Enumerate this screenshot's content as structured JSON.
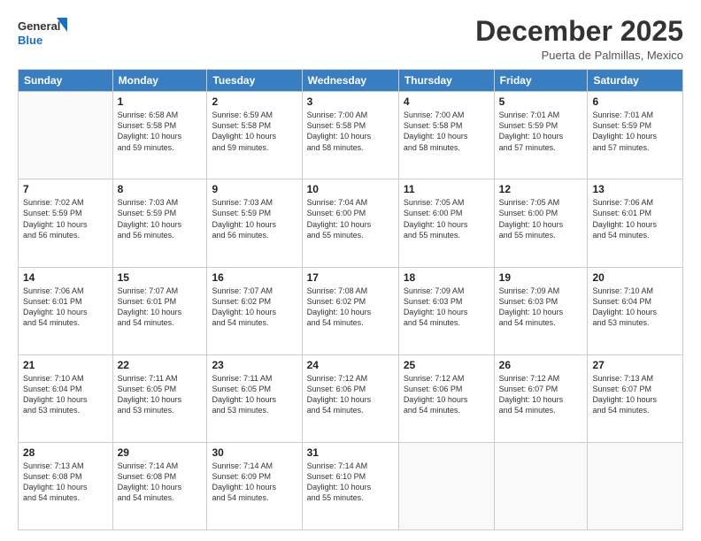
{
  "logo": {
    "general": "General",
    "blue": "Blue"
  },
  "header": {
    "month": "December 2025",
    "location": "Puerta de Palmillas, Mexico"
  },
  "weekdays": [
    "Sunday",
    "Monday",
    "Tuesday",
    "Wednesday",
    "Thursday",
    "Friday",
    "Saturday"
  ],
  "weeks": [
    [
      {
        "day": "",
        "info": ""
      },
      {
        "day": "1",
        "info": "Sunrise: 6:58 AM\nSunset: 5:58 PM\nDaylight: 10 hours\nand 59 minutes."
      },
      {
        "day": "2",
        "info": "Sunrise: 6:59 AM\nSunset: 5:58 PM\nDaylight: 10 hours\nand 59 minutes."
      },
      {
        "day": "3",
        "info": "Sunrise: 7:00 AM\nSunset: 5:58 PM\nDaylight: 10 hours\nand 58 minutes."
      },
      {
        "day": "4",
        "info": "Sunrise: 7:00 AM\nSunset: 5:58 PM\nDaylight: 10 hours\nand 58 minutes."
      },
      {
        "day": "5",
        "info": "Sunrise: 7:01 AM\nSunset: 5:59 PM\nDaylight: 10 hours\nand 57 minutes."
      },
      {
        "day": "6",
        "info": "Sunrise: 7:01 AM\nSunset: 5:59 PM\nDaylight: 10 hours\nand 57 minutes."
      }
    ],
    [
      {
        "day": "7",
        "info": "Sunrise: 7:02 AM\nSunset: 5:59 PM\nDaylight: 10 hours\nand 56 minutes."
      },
      {
        "day": "8",
        "info": "Sunrise: 7:03 AM\nSunset: 5:59 PM\nDaylight: 10 hours\nand 56 minutes."
      },
      {
        "day": "9",
        "info": "Sunrise: 7:03 AM\nSunset: 5:59 PM\nDaylight: 10 hours\nand 56 minutes."
      },
      {
        "day": "10",
        "info": "Sunrise: 7:04 AM\nSunset: 6:00 PM\nDaylight: 10 hours\nand 55 minutes."
      },
      {
        "day": "11",
        "info": "Sunrise: 7:05 AM\nSunset: 6:00 PM\nDaylight: 10 hours\nand 55 minutes."
      },
      {
        "day": "12",
        "info": "Sunrise: 7:05 AM\nSunset: 6:00 PM\nDaylight: 10 hours\nand 55 minutes."
      },
      {
        "day": "13",
        "info": "Sunrise: 7:06 AM\nSunset: 6:01 PM\nDaylight: 10 hours\nand 54 minutes."
      }
    ],
    [
      {
        "day": "14",
        "info": "Sunrise: 7:06 AM\nSunset: 6:01 PM\nDaylight: 10 hours\nand 54 minutes."
      },
      {
        "day": "15",
        "info": "Sunrise: 7:07 AM\nSunset: 6:01 PM\nDaylight: 10 hours\nand 54 minutes."
      },
      {
        "day": "16",
        "info": "Sunrise: 7:07 AM\nSunset: 6:02 PM\nDaylight: 10 hours\nand 54 minutes."
      },
      {
        "day": "17",
        "info": "Sunrise: 7:08 AM\nSunset: 6:02 PM\nDaylight: 10 hours\nand 54 minutes."
      },
      {
        "day": "18",
        "info": "Sunrise: 7:09 AM\nSunset: 6:03 PM\nDaylight: 10 hours\nand 54 minutes."
      },
      {
        "day": "19",
        "info": "Sunrise: 7:09 AM\nSunset: 6:03 PM\nDaylight: 10 hours\nand 54 minutes."
      },
      {
        "day": "20",
        "info": "Sunrise: 7:10 AM\nSunset: 6:04 PM\nDaylight: 10 hours\nand 53 minutes."
      }
    ],
    [
      {
        "day": "21",
        "info": "Sunrise: 7:10 AM\nSunset: 6:04 PM\nDaylight: 10 hours\nand 53 minutes."
      },
      {
        "day": "22",
        "info": "Sunrise: 7:11 AM\nSunset: 6:05 PM\nDaylight: 10 hours\nand 53 minutes."
      },
      {
        "day": "23",
        "info": "Sunrise: 7:11 AM\nSunset: 6:05 PM\nDaylight: 10 hours\nand 53 minutes."
      },
      {
        "day": "24",
        "info": "Sunrise: 7:12 AM\nSunset: 6:06 PM\nDaylight: 10 hours\nand 54 minutes."
      },
      {
        "day": "25",
        "info": "Sunrise: 7:12 AM\nSunset: 6:06 PM\nDaylight: 10 hours\nand 54 minutes."
      },
      {
        "day": "26",
        "info": "Sunrise: 7:12 AM\nSunset: 6:07 PM\nDaylight: 10 hours\nand 54 minutes."
      },
      {
        "day": "27",
        "info": "Sunrise: 7:13 AM\nSunset: 6:07 PM\nDaylight: 10 hours\nand 54 minutes."
      }
    ],
    [
      {
        "day": "28",
        "info": "Sunrise: 7:13 AM\nSunset: 6:08 PM\nDaylight: 10 hours\nand 54 minutes."
      },
      {
        "day": "29",
        "info": "Sunrise: 7:14 AM\nSunset: 6:08 PM\nDaylight: 10 hours\nand 54 minutes."
      },
      {
        "day": "30",
        "info": "Sunrise: 7:14 AM\nSunset: 6:09 PM\nDaylight: 10 hours\nand 54 minutes."
      },
      {
        "day": "31",
        "info": "Sunrise: 7:14 AM\nSunset: 6:10 PM\nDaylight: 10 hours\nand 55 minutes."
      },
      {
        "day": "",
        "info": ""
      },
      {
        "day": "",
        "info": ""
      },
      {
        "day": "",
        "info": ""
      }
    ]
  ]
}
